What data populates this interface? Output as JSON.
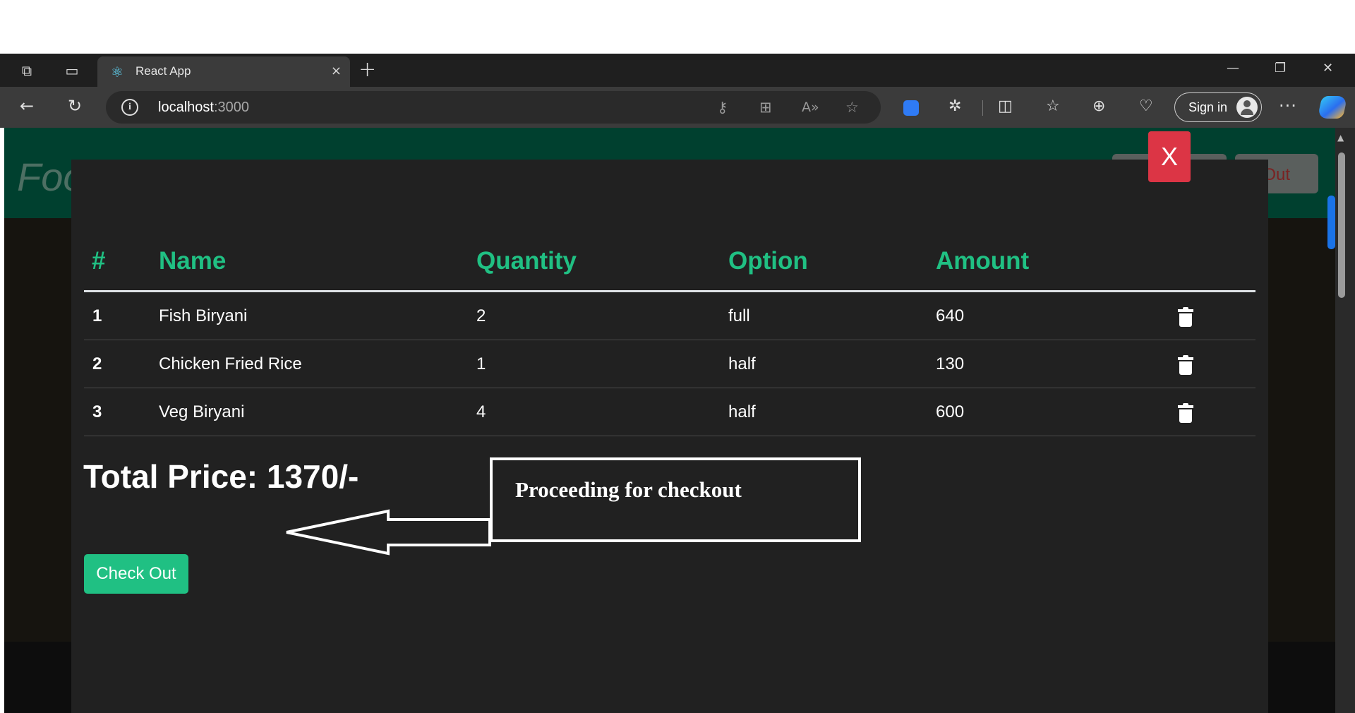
{
  "browser": {
    "tab_title": "React App",
    "tab_close": "×",
    "new_tab": "+",
    "address_host": "localhost",
    "address_port": ":3000",
    "sign_in_label": "Sign in",
    "more_label": "···",
    "window_controls": {
      "minimize": "—",
      "restore": "❐",
      "close": "✕"
    },
    "nav": {
      "back": "←",
      "reload": "↻"
    }
  },
  "app": {
    "brand": "Foo",
    "logout_label": "gOut"
  },
  "modal": {
    "close_label": "X",
    "table": {
      "headers": [
        "#",
        "Name",
        "Quantity",
        "Option",
        "Amount"
      ],
      "rows": [
        {
          "index": "1",
          "name": "Fish Biryani",
          "quantity": "2",
          "option": "full",
          "amount": "640"
        },
        {
          "index": "2",
          "name": "Chicken Fried Rice",
          "quantity": "1",
          "option": "half",
          "amount": "130"
        },
        {
          "index": "3",
          "name": "Veg Biryani",
          "quantity": "4",
          "option": "half",
          "amount": "600"
        }
      ]
    },
    "total_price": "Total Price: 1370/-",
    "checkout_label": "Check Out"
  },
  "annotation": {
    "text": "Proceeding for checkout"
  },
  "colors": {
    "accent_green": "#20c083",
    "close_red": "#dc3545",
    "modal_bg": "#212121",
    "navbar_green": "#00402f"
  }
}
